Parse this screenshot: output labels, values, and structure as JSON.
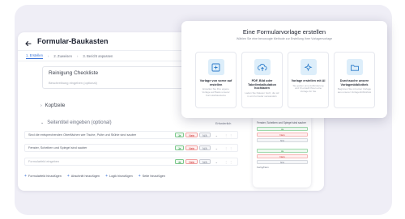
{
  "builder": {
    "title": "Formular-Baukasten",
    "steps": [
      "1. Erstellen",
      "2. Zuweisen",
      "3. Bericht anpassen"
    ],
    "form_title": "Reinigung Checkliste",
    "form_description": "Beschreibung eingeben (optional)",
    "section_header": "Kopfzeile",
    "section_title_placeholder": "Seitentitel eingeben (optional)",
    "column_header": "Erforderlich",
    "questions": [
      {
        "text": "Sind die entsprechenden Oberflächen wie Tische, Pulte und Stühle sind sauber"
      },
      {
        "text": "Fenster, Scheiben und Spiegel sind sauber"
      },
      {
        "text": "Formularfeld eingeben"
      }
    ],
    "answer_options": {
      "yes": "Ja",
      "no": "Nein",
      "na": "N/A"
    },
    "add_actions": [
      "Formularfeld hinzufügen",
      "Abschnitt hinzufügen",
      "Logik hinzufügen",
      "Seite hinzufügen"
    ]
  },
  "phone": {
    "question": "Fenster, Scheiben und Spiegel sind sauber",
    "answers": {
      "yes": "Ja",
      "no": "Nein",
      "na": "N/A"
    },
    "bottom_label": "Fertig/Nein"
  },
  "modal": {
    "title": "Eine Formularvorlage erstellen",
    "subtitle": "Wählen Sie eine bevorzugte Methode zur Erstellung Ihrer Vorlagenvorlage",
    "cards": [
      {
        "title": "Vorlage von vorne auf erstellen",
        "desc": "Erstellen Sie Ihre eigene Vorlage auf Basis unserer Formularbausteine",
        "icon": "add-icon"
      },
      {
        "title": "PDF, Bild oder Tabellenkalkulation hochladen",
        "desc": "Laden Sie Dateien hoch, die wir in ein Formular verwandeln",
        "icon": "upload-icon"
      },
      {
        "title": "Vorlage erstellen mit AI",
        "desc": "Sie geben eine Aufforderung und KI erstellt Ihnen eine Vorlage für Sie",
        "icon": "sparkle-icon"
      },
      {
        "title": "Durchsuche unsere Vorlagenbibliothek",
        "desc": "Beginnen Sie mit einer Vorlage aus unserer Vorlagenbibliothek",
        "icon": "folder-icon"
      }
    ]
  },
  "colors": {
    "accent": "#3b73d8",
    "yes": "#2b8a3e",
    "no": "#c92a2a",
    "backdrop": "#efeef6"
  }
}
